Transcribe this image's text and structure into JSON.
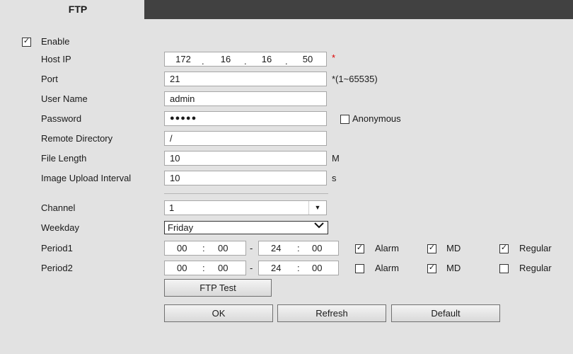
{
  "tab": {
    "title": "FTP"
  },
  "form": {
    "enable": {
      "label": "Enable",
      "checked": true
    },
    "host_ip": {
      "label": "Host IP",
      "octets": [
        "172",
        "16",
        "16",
        "50"
      ],
      "required_mark": "*"
    },
    "port": {
      "label": "Port",
      "value": "21",
      "hint": "*(1~65535)"
    },
    "user_name": {
      "label": "User Name",
      "value": "admin"
    },
    "password": {
      "label": "Password",
      "value": "●●●●●"
    },
    "anonymous": {
      "label": "Anonymous",
      "checked": false
    },
    "remote_directory": {
      "label": "Remote Directory",
      "value": "/"
    },
    "file_length": {
      "label": "File Length",
      "value": "10",
      "unit": "M"
    },
    "image_upload_interval": {
      "label": "Image Upload Interval",
      "value": "10",
      "unit": "s"
    },
    "channel": {
      "label": "Channel",
      "value": "1"
    },
    "weekday": {
      "label": "Weekday",
      "value": "Friday"
    },
    "period_separator": "-",
    "time_colon": ":",
    "periods": [
      {
        "label": "Period1",
        "start": [
          "00",
          "00"
        ],
        "end": [
          "24",
          "00"
        ],
        "alarm": {
          "label": "Alarm",
          "checked": true
        },
        "md": {
          "label": "MD",
          "checked": true
        },
        "regular": {
          "label": "Regular",
          "checked": true
        }
      },
      {
        "label": "Period2",
        "start": [
          "00",
          "00"
        ],
        "end": [
          "24",
          "00"
        ],
        "alarm": {
          "label": "Alarm",
          "checked": false
        },
        "md": {
          "label": "MD",
          "checked": true
        },
        "regular": {
          "label": "Regular",
          "checked": false
        }
      }
    ]
  },
  "buttons": {
    "ftp_test": "FTP Test",
    "ok": "OK",
    "refresh": "Refresh",
    "default": "Default"
  },
  "icons": {
    "dropdown": "chevron-down-icon",
    "checkbox": "checkmark-icon"
  }
}
